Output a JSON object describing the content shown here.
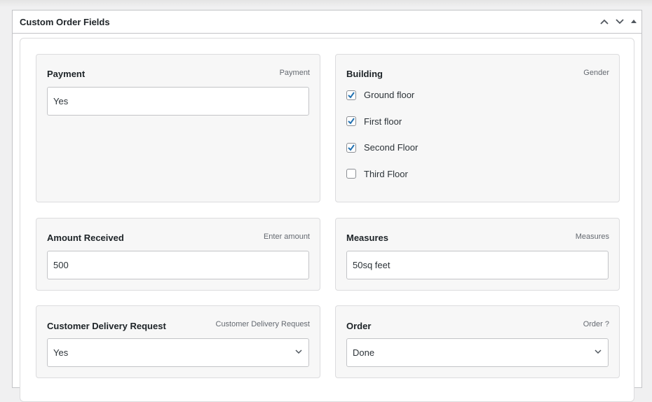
{
  "panel": {
    "title": "Custom Order Fields"
  },
  "fields": {
    "payment": {
      "label": "Payment",
      "hint": "Payment",
      "value": "Yes"
    },
    "building": {
      "label": "Building",
      "hint": "Gender",
      "options": [
        {
          "label": "Ground floor",
          "checked": true
        },
        {
          "label": "First floor",
          "checked": true
        },
        {
          "label": "Second Floor",
          "checked": true
        },
        {
          "label": "Third Floor",
          "checked": false
        }
      ]
    },
    "amount": {
      "label": "Amount Received",
      "hint": "Enter amount",
      "value": "500"
    },
    "measures": {
      "label": "Measures",
      "hint": "Measures",
      "value": "50sq feet"
    },
    "delivery": {
      "label": "Customer Delivery Request",
      "hint": "Customer Delivery Request",
      "value": "Yes"
    },
    "order": {
      "label": "Order",
      "hint": "Order ?",
      "value": "Done"
    }
  },
  "colors": {
    "accent": "#2271b1"
  }
}
